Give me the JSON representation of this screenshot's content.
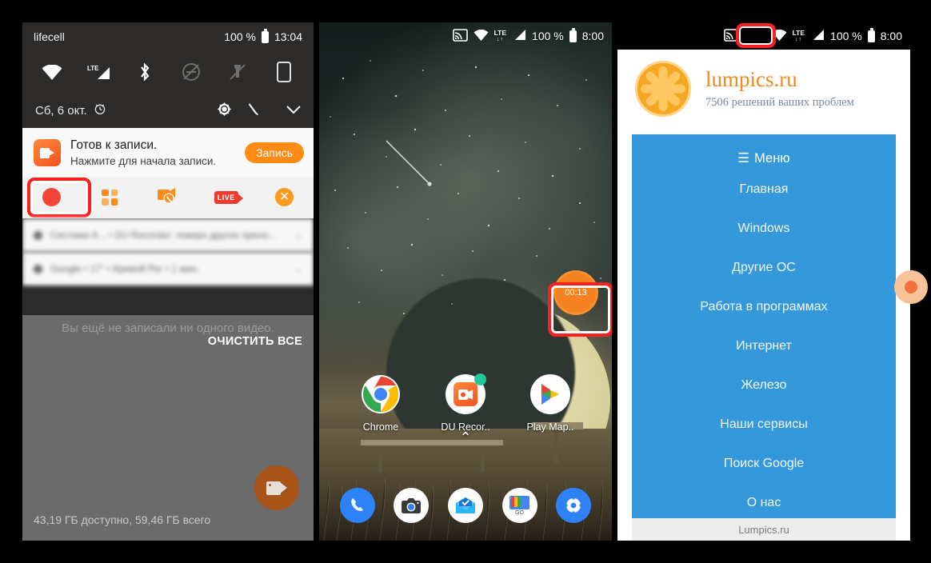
{
  "panel_notification": {
    "status_bar": {
      "carrier": "lifecell",
      "battery_percent": "100 %",
      "time": "13:04",
      "icons": [
        "wifi-icon",
        "lte-signal-icon",
        "bluetooth-icon",
        "do-not-disturb-icon",
        "flashlight-off-icon",
        "screen-rotation-icon"
      ],
      "lte_label": "LTE"
    },
    "date_row": {
      "date": "Сб, 6 окт.",
      "alarm_icon": "alarm-clock-icon",
      "settings_icon": "gear-icon",
      "edit_icon": "wrench-icon",
      "collapse_icon": "chevron-down-icon"
    },
    "notification": {
      "app_icon": "du-recorder-icon",
      "title": "Готов к записи.",
      "subtitle": "Нажмите для начала записи.",
      "action_button": "Запись",
      "actions": [
        {
          "name": "record-button",
          "icon": "red-record-dot-icon",
          "highlighted": true
        },
        {
          "name": "tools-grid-button",
          "icon": "grid-four-squares-icon",
          "highlighted": false
        },
        {
          "name": "settings-camera-button",
          "icon": "camera-wrench-icon",
          "highlighted": false
        },
        {
          "name": "live-button",
          "icon": "live-badge-icon",
          "label": "LIVE",
          "highlighted": false
        },
        {
          "name": "close-button",
          "icon": "close-circle-icon",
          "highlighted": false
        }
      ]
    },
    "obscured_rows": [
      {
        "text": "Система А...  • DU Recorder: поверх других прило..."
      },
      {
        "text": "Google • 17° • Кривой Рог • 1 мин."
      }
    ],
    "gallery": {
      "empty_text": "Вы ещё не записали ни одного видео.",
      "clear_all": "ОЧИСТИТЬ ВСЕ",
      "storage": "43,19 ГБ доступно, 59,46 ГБ всего",
      "fab_icon": "video-camera-icon"
    }
  },
  "panel_home": {
    "status_bar": {
      "cast_icon": "cast-screen-icon",
      "wifi_icon": "wifi-icon",
      "lte_label": "LTE",
      "lte_arrows": "↓↑",
      "signal_icon": "cell-signal-icon",
      "battery_percent": "100 %",
      "time": "8:00"
    },
    "floating_timer": {
      "value": "00:13",
      "highlighted": true
    },
    "apps": [
      {
        "label": "Chrome",
        "icon": "chrome-icon"
      },
      {
        "label": "DU Recor..",
        "icon": "du-recorder-icon",
        "badge": true
      },
      {
        "label": "Play Map..",
        "icon": "play-store-icon"
      }
    ],
    "drawer_indicator": "chevron-up-icon",
    "dock": [
      {
        "name": "phone-icon"
      },
      {
        "name": "camera-icon"
      },
      {
        "name": "inbox-icon"
      },
      {
        "name": "files-go-icon",
        "label": "GO"
      },
      {
        "name": "settings-gear-icon"
      }
    ]
  },
  "panel_site": {
    "status_bar": {
      "cast_icon": "cast-screen-icon",
      "wifi_icon": "wifi-icon",
      "lte_label": "LTE",
      "lte_arrows": "↓↑",
      "signal_icon": "cell-signal-icon",
      "battery_percent": "100 %",
      "time": "8:00",
      "cast_highlighted": true
    },
    "header": {
      "logo": "orange-slice-logo",
      "title": "lumpics.ru",
      "subtitle": "7506 решений ваших проблем"
    },
    "menu": {
      "header_label": "Меню",
      "burger_icon": "hamburger-menu-icon",
      "items": [
        "Главная",
        "Windows",
        "Другие ОС",
        "Работа в программах",
        "Интернет",
        "Железо",
        "Наши сервисы",
        "Поиск Google",
        "О нас"
      ]
    },
    "footer": "Lumpics.ru",
    "edge_bubble": "floating-widget-partial"
  },
  "colors": {
    "accent_orange": "#f58220",
    "record_red": "#f3443a",
    "highlight_red": "#fb1f1f",
    "site_blue": "#3498db",
    "brand_orange": "#f08a1e"
  }
}
